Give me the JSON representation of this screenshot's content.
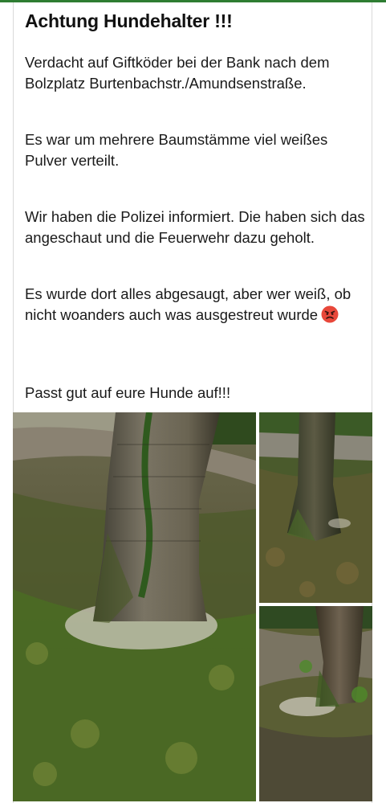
{
  "post": {
    "title": "Achtung Hundehalter !!!",
    "paragraphs": [
      "Verdacht auf Giftköder bei der Bank nach dem Bolzplatz Burtenbachstr./Amundsenstraße.",
      "Es war um mehrere Baumstämme viel weißes Pulver verteilt.",
      "Wir haben die Polizei informiert. Die haben sich das angeschaut und die Feuerwehr dazu geholt.",
      "Es wurde dort alles abgesaugt, aber wer weiß, ob nicht woanders auch was ausgestreut wurde",
      "Passt gut auf eure Hunde auf!!!"
    ],
    "emoji": "angry-face-emoji"
  },
  "colors": {
    "accent": "#2e7d32",
    "text": "#1a1a1a",
    "emoji": "#e8473a"
  },
  "photos": [
    {
      "name": "tree-photo-large"
    },
    {
      "name": "tree-photo-top-right"
    },
    {
      "name": "tree-photo-bottom-right"
    }
  ]
}
